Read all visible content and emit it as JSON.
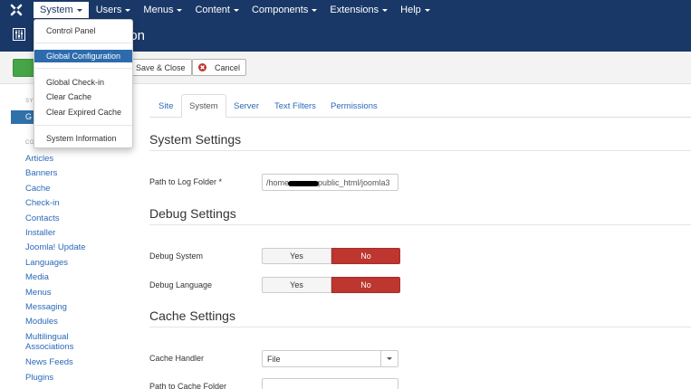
{
  "topnav": {
    "items": [
      {
        "label": "System"
      },
      {
        "label": "Users"
      },
      {
        "label": "Menus"
      },
      {
        "label": "Content"
      },
      {
        "label": "Components"
      },
      {
        "label": "Extensions"
      },
      {
        "label": "Help"
      }
    ]
  },
  "header": {
    "title": "ion"
  },
  "toolbar": {
    "save_close_label": "Save & Close",
    "cancel_label": "Cancel"
  },
  "system_menu": {
    "items": [
      {
        "label": "Control Panel"
      },
      {
        "label": "Global Configuration"
      },
      {
        "label": "Global Check-in"
      },
      {
        "label": "Clear Cache"
      },
      {
        "label": "Clear Expired Cache"
      },
      {
        "label": "System Information"
      }
    ]
  },
  "sidebar": {
    "system_heading": "SY",
    "active_item": "G",
    "component_heading": "CO",
    "components": [
      "Articles",
      "Banners",
      "Cache",
      "Check-in",
      "Contacts",
      "Installer",
      "Joomla! Update",
      "Languages",
      "Media",
      "Menus",
      "Messaging",
      "Modules",
      "Multilingual Associations",
      "News Feeds",
      "Plugins"
    ]
  },
  "tabs": [
    {
      "label": "Site"
    },
    {
      "label": "System"
    },
    {
      "label": "Server"
    },
    {
      "label": "Text Filters"
    },
    {
      "label": "Permissions"
    }
  ],
  "content": {
    "system_settings_title": "System Settings",
    "log_path_label": "Path to Log Folder *",
    "log_path_prefix": "/home",
    "log_path_suffix": "public_html/joomla3",
    "debug_settings_title": "Debug Settings",
    "debug_system_label": "Debug System",
    "debug_language_label": "Debug Language",
    "yes_label": "Yes",
    "no_label": "No",
    "cache_settings_title": "Cache Settings",
    "cache_handler_label": "Cache Handler",
    "cache_handler_value": "File",
    "cache_path_label": "Path to Cache Folder"
  },
  "colors": {
    "nav_bg": "#1a3867",
    "accent_blue": "#2d6bad",
    "no_red": "#bd362f",
    "save_green": "#46a546"
  }
}
